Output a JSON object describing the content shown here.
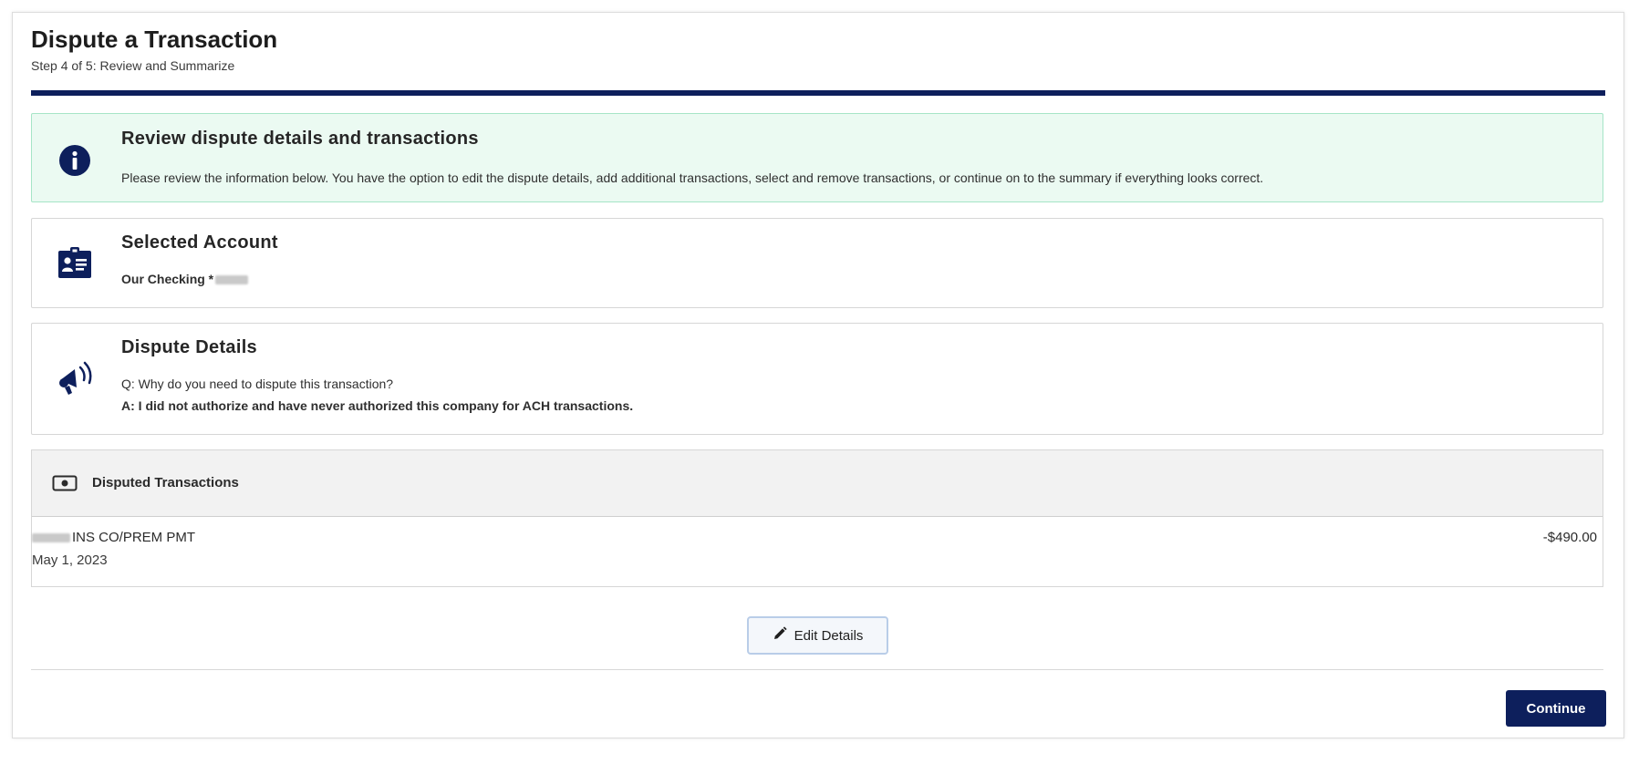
{
  "page": {
    "title": "Dispute a Transaction",
    "step": "Step 4 of 5: Review and Summarize"
  },
  "info": {
    "heading": "Review dispute details and transactions",
    "text": "Please review the information below. You have the option to edit the dispute details, add additional transactions, select and remove transactions, or continue on to the summary if everything looks correct."
  },
  "account": {
    "heading": "Selected Account",
    "name": "Our Checking *"
  },
  "dispute": {
    "heading": "Dispute Details",
    "question": "Q: Why do you need to dispute this transaction?",
    "answer": "A: I did not authorize and have never authorized this company for ACH transactions."
  },
  "transactions": {
    "heading": "Disputed Transactions",
    "items": [
      {
        "description": "INS CO/PREM PMT",
        "date": "May 1, 2023",
        "amount": "-$490.00"
      }
    ]
  },
  "actions": {
    "edit_label": "Edit Details",
    "continue_label": "Continue"
  },
  "colors": {
    "primary": "#0d1f5c",
    "info_background": "#ebfaf2",
    "info_border": "#a6e5c7"
  },
  "icons": {
    "info": "info-circle-icon",
    "account": "id-card-icon",
    "dispute": "megaphone-icon",
    "transactions": "cash-icon",
    "edit": "pencil-icon"
  }
}
